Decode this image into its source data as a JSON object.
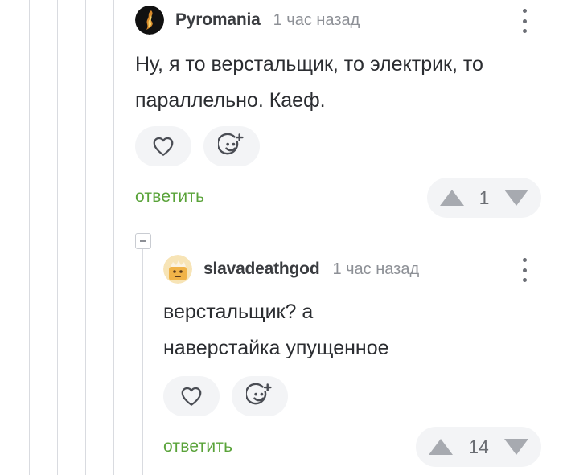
{
  "comments": [
    {
      "username": "Pyromania",
      "time": "1 час назад",
      "lines": [
        "Ну, я то верстальщик, то электрик, то",
        "параллельно. Каеф."
      ],
      "reply_label": "ответить",
      "rating": "1"
    },
    {
      "username": "slavadeathgod",
      "time": "1 час назад",
      "lines": [
        "верстальщик? а",
        "наверстайка упущенное"
      ],
      "reply_label": "ответить",
      "rating": "14"
    }
  ],
  "colors": {
    "reply_link": "#5aa33a",
    "pill_bg": "#f3f4f6",
    "vote_arrow": "#a7aab0",
    "thread_line": "#d9dbe0"
  },
  "icons": [
    "heart-icon",
    "emoji-add-icon",
    "upvote-icon",
    "downvote-icon",
    "more-icon",
    "collapse-icon"
  ]
}
